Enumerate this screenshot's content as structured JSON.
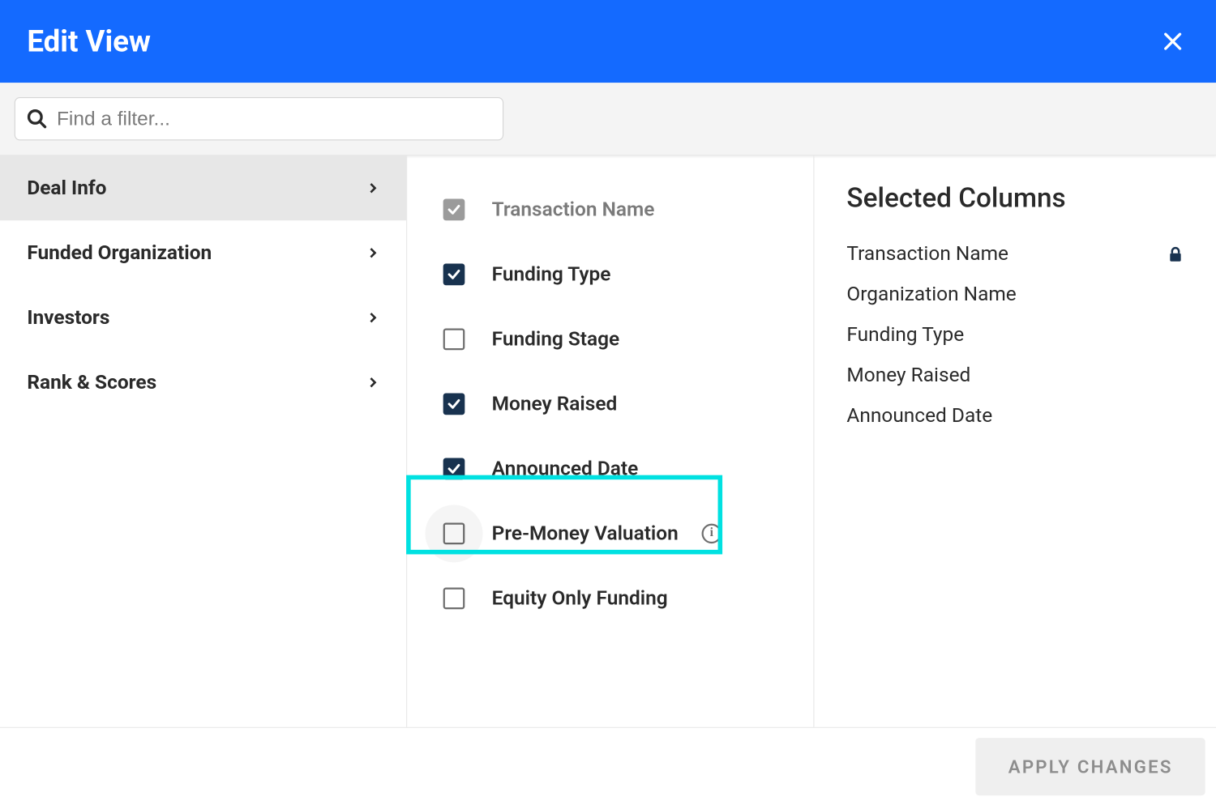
{
  "header": {
    "title": "Edit View"
  },
  "search": {
    "placeholder": "Find a filter..."
  },
  "categories": [
    {
      "label": "Deal Info",
      "active": true
    },
    {
      "label": "Funded Organization",
      "active": false
    },
    {
      "label": "Investors",
      "active": false
    },
    {
      "label": "Rank & Scores",
      "active": false
    }
  ],
  "filters": [
    {
      "label": "Transaction Name",
      "state": "locked"
    },
    {
      "label": "Funding Type",
      "state": "checked"
    },
    {
      "label": "Funding Stage",
      "state": "unchecked"
    },
    {
      "label": "Money Raised",
      "state": "checked"
    },
    {
      "label": "Announced Date",
      "state": "checked"
    },
    {
      "label": "Pre-Money Valuation",
      "state": "unchecked",
      "info": true,
      "highlight": true
    },
    {
      "label": "Equity Only Funding",
      "state": "unchecked"
    }
  ],
  "selected": {
    "title": "Selected Columns",
    "items": [
      {
        "label": "Transaction Name",
        "locked": true
      },
      {
        "label": "Organization Name",
        "locked": false
      },
      {
        "label": "Funding Type",
        "locked": false
      },
      {
        "label": "Money Raised",
        "locked": false
      },
      {
        "label": "Announced Date",
        "locked": false
      }
    ]
  },
  "footer": {
    "apply_label": "APPLY CHANGES"
  }
}
